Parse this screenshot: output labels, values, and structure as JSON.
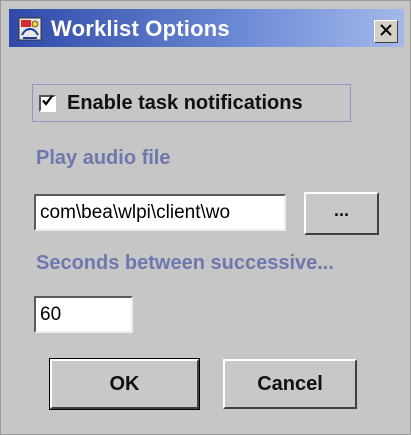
{
  "window": {
    "title": "Worklist Options",
    "close_label": "close"
  },
  "notifications": {
    "checkbox_label": "Enable task notifications",
    "checked": true
  },
  "audio": {
    "label": "Play audio file",
    "path_value": "com\\bea\\wlpi\\client\\wo",
    "browse_label": "..."
  },
  "interval": {
    "label": "Seconds between successive...",
    "value": "60"
  },
  "actions": {
    "ok_label": "OK",
    "cancel_label": "Cancel"
  },
  "colors": {
    "title_bar": "#2f4aa8",
    "section_label": "#6f78ae",
    "dialog_bg": "#c6c6c6"
  },
  "icons": {
    "app": "app-icon",
    "close": "close-icon",
    "check": "checkmark-icon"
  }
}
